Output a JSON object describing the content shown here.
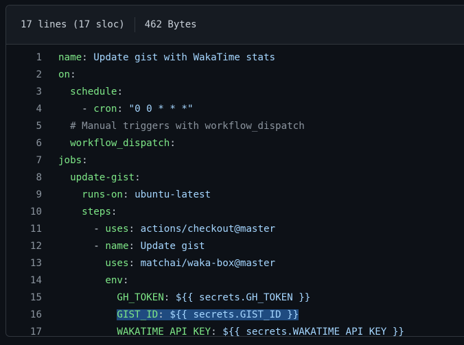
{
  "file_info": {
    "lines": "17 lines (17 sloc)",
    "size": "462 Bytes"
  },
  "code_lines": [
    {
      "num": "1",
      "indent": "",
      "key": "name",
      "sep": ": ",
      "val": "Update gist with WakaTime stats"
    },
    {
      "num": "2",
      "indent": "",
      "key": "on",
      "sep": ":",
      "val": ""
    },
    {
      "num": "3",
      "indent": "  ",
      "key": "schedule",
      "sep": ":",
      "val": ""
    },
    {
      "num": "4",
      "indent": "    ",
      "dash": "- ",
      "key": "cron",
      "sep": ": ",
      "val": "\"0 0 * * *\""
    },
    {
      "num": "5",
      "indent": "  ",
      "comment": "# Manual triggers with workflow_dispatch"
    },
    {
      "num": "6",
      "indent": "  ",
      "key": "workflow_dispatch",
      "sep": ":",
      "val": ""
    },
    {
      "num": "7",
      "indent": "",
      "key": "jobs",
      "sep": ":",
      "val": ""
    },
    {
      "num": "8",
      "indent": "  ",
      "key": "update-gist",
      "sep": ":",
      "val": ""
    },
    {
      "num": "9",
      "indent": "    ",
      "key": "runs-on",
      "sep": ": ",
      "val": "ubuntu-latest"
    },
    {
      "num": "10",
      "indent": "    ",
      "key": "steps",
      "sep": ":",
      "val": ""
    },
    {
      "num": "11",
      "indent": "      ",
      "dash": "- ",
      "key": "uses",
      "sep": ": ",
      "val": "actions/checkout@master"
    },
    {
      "num": "12",
      "indent": "      ",
      "dash": "- ",
      "key": "name",
      "sep": ": ",
      "val": "Update gist"
    },
    {
      "num": "13",
      "indent": "        ",
      "key": "uses",
      "sep": ": ",
      "val": "matchai/waka-box@master"
    },
    {
      "num": "14",
      "indent": "        ",
      "key": "env",
      "sep": ":",
      "val": ""
    },
    {
      "num": "15",
      "indent": "          ",
      "key": "GH_TOKEN",
      "sep": ": ",
      "val": "${{ secrets.GH_TOKEN }}"
    },
    {
      "num": "16",
      "indent": "          ",
      "key": "GIST_ID",
      "sep": ": ",
      "val": "${{ secrets.GIST_ID }}",
      "selected": true
    },
    {
      "num": "17",
      "indent": "          ",
      "key": "WAKATIME_API_KEY",
      "sep": ": ",
      "val": "${{ secrets.WAKATIME_API_KEY }}"
    }
  ],
  "colors": {
    "background": "#0d1117",
    "key": "#7ee787",
    "value": "#a5d6ff",
    "comment": "#8b949e",
    "selection": "#1f4b80"
  }
}
